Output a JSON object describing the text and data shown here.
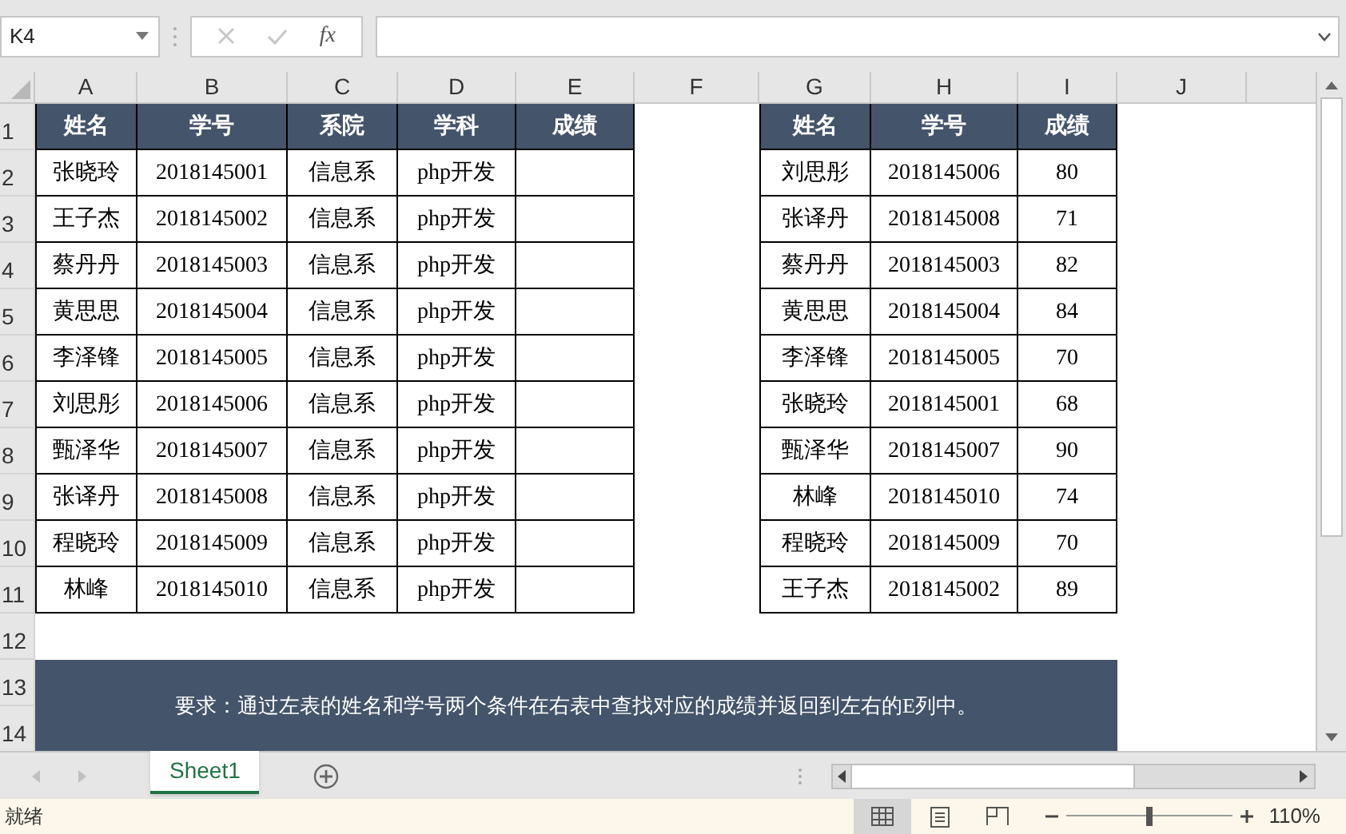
{
  "name_box": "K4",
  "formula_bar": {
    "function_label": "fx"
  },
  "columns": [
    "A",
    "B",
    "C",
    "D",
    "E",
    "F",
    "G",
    "H",
    "I",
    "J"
  ],
  "row_numbers": [
    "1",
    "2",
    "3",
    "4",
    "5",
    "6",
    "7",
    "8",
    "9",
    "10",
    "11",
    "12",
    "13",
    "14"
  ],
  "left_table": {
    "headers": [
      "姓名",
      "学号",
      "系院",
      "学科",
      "成绩"
    ],
    "rows": [
      [
        "张晓玲",
        "2018145001",
        "信息系",
        "php开发",
        ""
      ],
      [
        "王子杰",
        "2018145002",
        "信息系",
        "php开发",
        ""
      ],
      [
        "蔡丹丹",
        "2018145003",
        "信息系",
        "php开发",
        ""
      ],
      [
        "黄思思",
        "2018145004",
        "信息系",
        "php开发",
        ""
      ],
      [
        "李泽锋",
        "2018145005",
        "信息系",
        "php开发",
        ""
      ],
      [
        "刘思彤",
        "2018145006",
        "信息系",
        "php开发",
        ""
      ],
      [
        "甄泽华",
        "2018145007",
        "信息系",
        "php开发",
        ""
      ],
      [
        "张译丹",
        "2018145008",
        "信息系",
        "php开发",
        ""
      ],
      [
        "程晓玲",
        "2018145009",
        "信息系",
        "php开发",
        ""
      ],
      [
        "林峰",
        "2018145010",
        "信息系",
        "php开发",
        ""
      ]
    ]
  },
  "right_table": {
    "headers": [
      "姓名",
      "学号",
      "成绩"
    ],
    "rows": [
      [
        "刘思彤",
        "2018145006",
        "80"
      ],
      [
        "张译丹",
        "2018145008",
        "71"
      ],
      [
        "蔡丹丹",
        "2018145003",
        "82"
      ],
      [
        "黄思思",
        "2018145004",
        "84"
      ],
      [
        "李泽锋",
        "2018145005",
        "70"
      ],
      [
        "张晓玲",
        "2018145001",
        "68"
      ],
      [
        "甄泽华",
        "2018145007",
        "90"
      ],
      [
        "林峰",
        "2018145010",
        "74"
      ],
      [
        "程晓玲",
        "2018145009",
        "70"
      ],
      [
        "王子杰",
        "2018145002",
        "89"
      ]
    ]
  },
  "note": "要求：通过左表的姓名和学号两个条件在右表中查找对应的成绩并返回到左右的E列中。",
  "sheet_tabs": [
    {
      "label": "Sheet1",
      "selected": true
    }
  ],
  "status_bar": {
    "status": "就绪",
    "view_buttons": [
      {
        "kind": "normal",
        "selected": true
      },
      {
        "kind": "page_layout",
        "selected": false
      },
      {
        "kind": "page_break",
        "selected": false
      }
    ],
    "zoom": {
      "level": 0.5,
      "reading": "110%"
    }
  }
}
